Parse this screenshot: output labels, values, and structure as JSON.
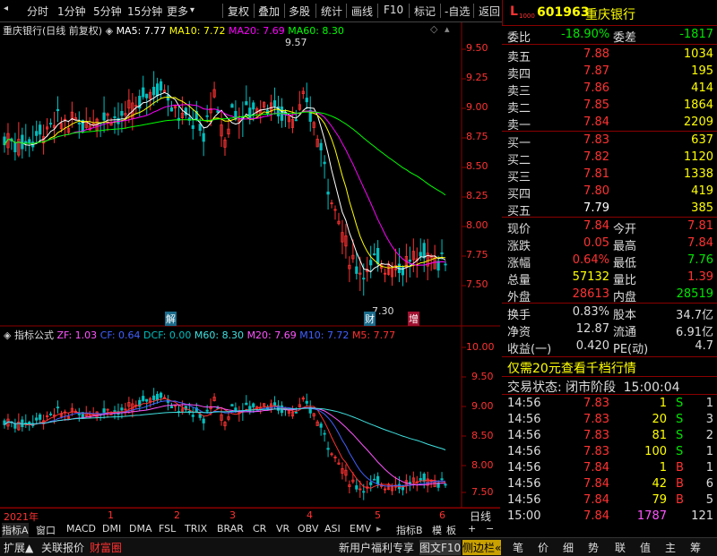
{
  "toolbar": {
    "left_buttons": [
      "分时",
      "1分钟",
      "5分钟",
      "15分钟",
      "更多"
    ],
    "right_buttons": [
      "复权",
      "叠加",
      "多股",
      "统计",
      "画线",
      "F10",
      "标记",
      "-自选",
      "返回"
    ]
  },
  "stock": {
    "code": "601963",
    "name": "重庆银行",
    "badge": "L",
    "badge_sub": "1000"
  },
  "main_legend": {
    "title": "重庆银行(日线 前复权)",
    "ma5": "MA5: 7.77",
    "ma10": "MA10: 7.72",
    "ma20": "MA20: 7.69",
    "ma60": "MA60: 8.30"
  },
  "main_axis": [
    "9.50",
    "9.25",
    "9.00",
    "8.75",
    "8.50",
    "8.25",
    "8.00",
    "7.75",
    "7.50"
  ],
  "main_annotations": {
    "high": "9.57",
    "low": "7.30",
    "mark_jie": "解",
    "mark_cai": "财",
    "mark_zeng": "增"
  },
  "ind_legend": {
    "title": "指标公式",
    "zf": "ZF: 1.03",
    "cf": "CF: 0.64",
    "dcf": "DCF: 0.00",
    "m60": "M60: 8.30",
    "m20": "M20: 7.69",
    "m10": "M10: 7.72",
    "m5": "M5: 7.77"
  },
  "ind_axis": [
    "10.00",
    "9.50",
    "9.00",
    "8.50",
    "8.00",
    "7.50"
  ],
  "time_axis": {
    "year": "2021年",
    "months": [
      "1",
      "2",
      "3",
      "4",
      "5",
      "6"
    ],
    "period": "日线"
  },
  "tabs": [
    "指标A",
    "窗口",
    "MACD",
    "DMI",
    "DMA",
    "FSL",
    "TRIX",
    "BRAR",
    "CR",
    "VR",
    "OBV",
    "ASI",
    "EMV",
    "▸",
    "指标B",
    "模",
    "板",
    "+",
    "−"
  ],
  "statusbar_left": [
    "扩展▲",
    "关联报价",
    "财富圈"
  ],
  "statusbar_mid": [
    "新用户福利专享",
    "图文F10",
    "侧边栏«"
  ],
  "statusbar_right": [
    "笔",
    "价",
    "细",
    "势",
    "联",
    "值",
    "主",
    "筹"
  ],
  "quote": {
    "weibi_label": "委比",
    "weibi": "-18.90%",
    "weicha_label": "委差",
    "weicha": "-1817",
    "asks": [
      {
        "label": "卖五",
        "price": "7.88",
        "vol": "1034"
      },
      {
        "label": "卖四",
        "price": "7.87",
        "vol": "195"
      },
      {
        "label": "卖三",
        "price": "7.86",
        "vol": "414"
      },
      {
        "label": "卖二",
        "price": "7.85",
        "vol": "1864"
      },
      {
        "label": "卖一",
        "price": "7.84",
        "vol": "2209"
      }
    ],
    "bids": [
      {
        "label": "买一",
        "price": "7.83",
        "vol": "637"
      },
      {
        "label": "买二",
        "price": "7.82",
        "vol": "1120"
      },
      {
        "label": "买三",
        "price": "7.81",
        "vol": "1338"
      },
      {
        "label": "买四",
        "price": "7.80",
        "vol": "419"
      },
      {
        "label": "买五",
        "price": "7.79",
        "vol": "385"
      }
    ],
    "stats": [
      {
        "l1": "现价",
        "v1": "7.84",
        "c1": "red",
        "l2": "今开",
        "v2": "7.81",
        "c2": "red"
      },
      {
        "l1": "涨跌",
        "v1": "0.05",
        "c1": "red",
        "l2": "最高",
        "v2": "7.84",
        "c2": "red"
      },
      {
        "l1": "涨幅",
        "v1": "0.64%",
        "c1": "red",
        "l2": "最低",
        "v2": "7.76",
        "c2": "green"
      },
      {
        "l1": "总量",
        "v1": "57132",
        "c1": "yellow",
        "l2": "量比",
        "v2": "1.39",
        "c2": "red"
      },
      {
        "l1": "外盘",
        "v1": "28613",
        "c1": "red",
        "l2": "内盘",
        "v2": "28519",
        "c2": "green"
      }
    ],
    "stats2": [
      {
        "l1": "换手",
        "v1": "0.83%",
        "l2": "股本",
        "v2": "34.7亿"
      },
      {
        "l1": "净资",
        "v1": "12.87",
        "l2": "流通",
        "v2": "6.91亿"
      },
      {
        "l1": "收益(一)",
        "v1": "0.420",
        "l2": "PE(动)",
        "v2": "4.7"
      }
    ],
    "promo": "仅需20元查看千档行情",
    "trade_status_label": "交易状态: 闭市阶段",
    "trade_status_time": "15:00:04",
    "ticks": [
      {
        "t": "14:56",
        "p": "7.83",
        "pc": "red",
        "v": "1",
        "bs": "S",
        "bc": "green",
        "n": "1"
      },
      {
        "t": "14:56",
        "p": "7.83",
        "pc": "red",
        "v": "20",
        "bs": "S",
        "bc": "green",
        "n": "3"
      },
      {
        "t": "14:56",
        "p": "7.83",
        "pc": "red",
        "v": "81",
        "bs": "S",
        "bc": "green",
        "n": "2"
      },
      {
        "t": "14:56",
        "p": "7.83",
        "pc": "red",
        "v": "100",
        "bs": "S",
        "bc": "green",
        "n": "1"
      },
      {
        "t": "14:56",
        "p": "7.84",
        "pc": "red",
        "v": "1",
        "bs": "B",
        "bc": "red",
        "n": "1"
      },
      {
        "t": "14:56",
        "p": "7.84",
        "pc": "red",
        "v": "42",
        "bs": "B",
        "bc": "red",
        "n": "6"
      },
      {
        "t": "14:56",
        "p": "7.84",
        "pc": "red",
        "v": "79",
        "bs": "B",
        "bc": "red",
        "n": "5"
      },
      {
        "t": "15:00",
        "p": "7.84",
        "pc": "red",
        "v": "1787",
        "bs": "",
        "bc": "white",
        "n": "121"
      }
    ]
  },
  "colors": {
    "up": "#ff3232",
    "down": "#00e600",
    "ma5": "#ffffff",
    "ma10": "#ffff00",
    "ma20": "#ff00ff",
    "ma60": "#00ff00",
    "axis": "#8b0000"
  }
}
